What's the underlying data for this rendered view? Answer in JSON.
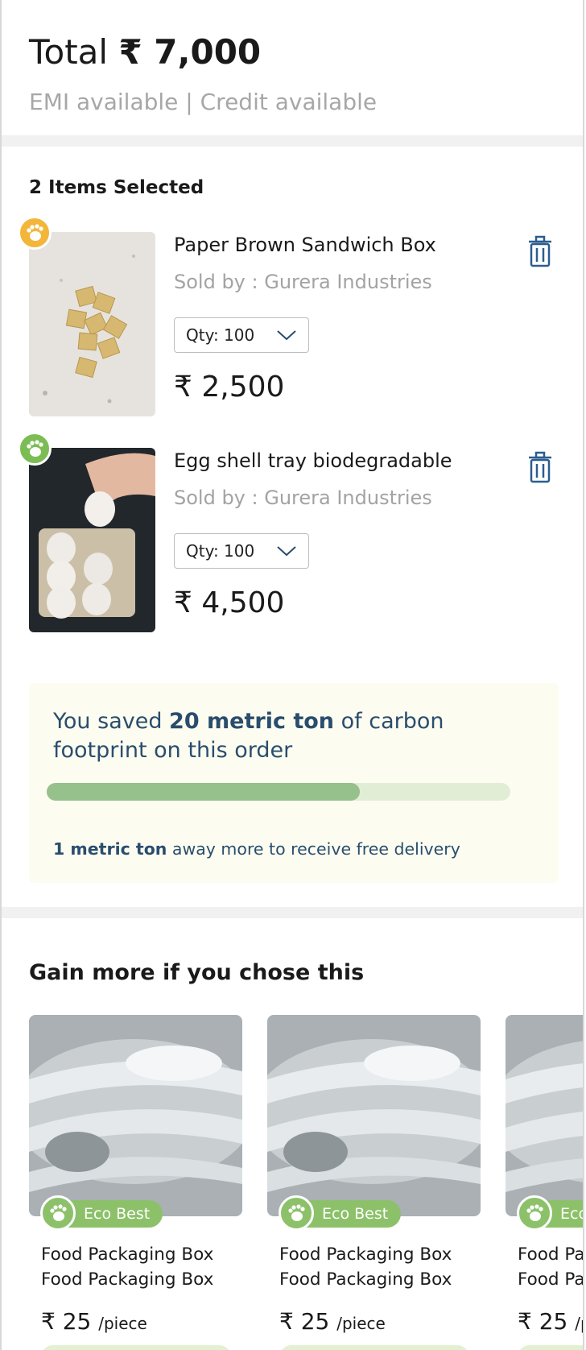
{
  "summary": {
    "total_label": "Total",
    "total_amount": "₹ 7,000",
    "availability": "EMI available | Credit available"
  },
  "cart": {
    "heading": "2 Items Selected",
    "items": [
      {
        "name": "Paper Brown Sandwich Box",
        "seller": "Sold by : Gurera Industries",
        "qty": "Qty: 100",
        "price": "₹ 2,500",
        "badge_color": "#f2b63a",
        "icon": "trash-icon"
      },
      {
        "name": "Egg shell tray biodegradable",
        "seller": "Sold by : Gurera Industries",
        "qty": "Qty: 100",
        "price": "₹ 4,500",
        "badge_color": "#7bbd54",
        "icon": "trash-icon"
      }
    ]
  },
  "carbon": {
    "msg_prefix": "You saved ",
    "msg_amount": "20 metric ton",
    "msg_suffix": " of carbon footprint on this order",
    "progress_fraction": 0.675,
    "note_amount": "1 metric ton",
    "note_suffix": " away more to receive free delivery"
  },
  "recommendations": {
    "heading": "Gain more if you chose this",
    "cards": [
      {
        "badge": "Eco Best",
        "line1": "Food Packaging Box",
        "line2": "Food Packaging Box",
        "price": "₹ 25",
        "unit": "/piece"
      },
      {
        "badge": "Eco Best",
        "line1": "Food Packaging Box",
        "line2": "Food Packaging Box",
        "price": "₹ 25",
        "unit": "/piece"
      },
      {
        "badge": "Eco Best",
        "line1": "Food Packaging Box",
        "line2": "Food Packaging Box",
        "price": "₹ 25",
        "unit": "/piece"
      }
    ]
  },
  "colors": {
    "text_primary": "#1a1a1a",
    "text_muted": "#a3a3a3",
    "accent_blue": "#2a4d6e",
    "eco_green": "#8cc16a",
    "progress_fill": "#96c08c"
  }
}
